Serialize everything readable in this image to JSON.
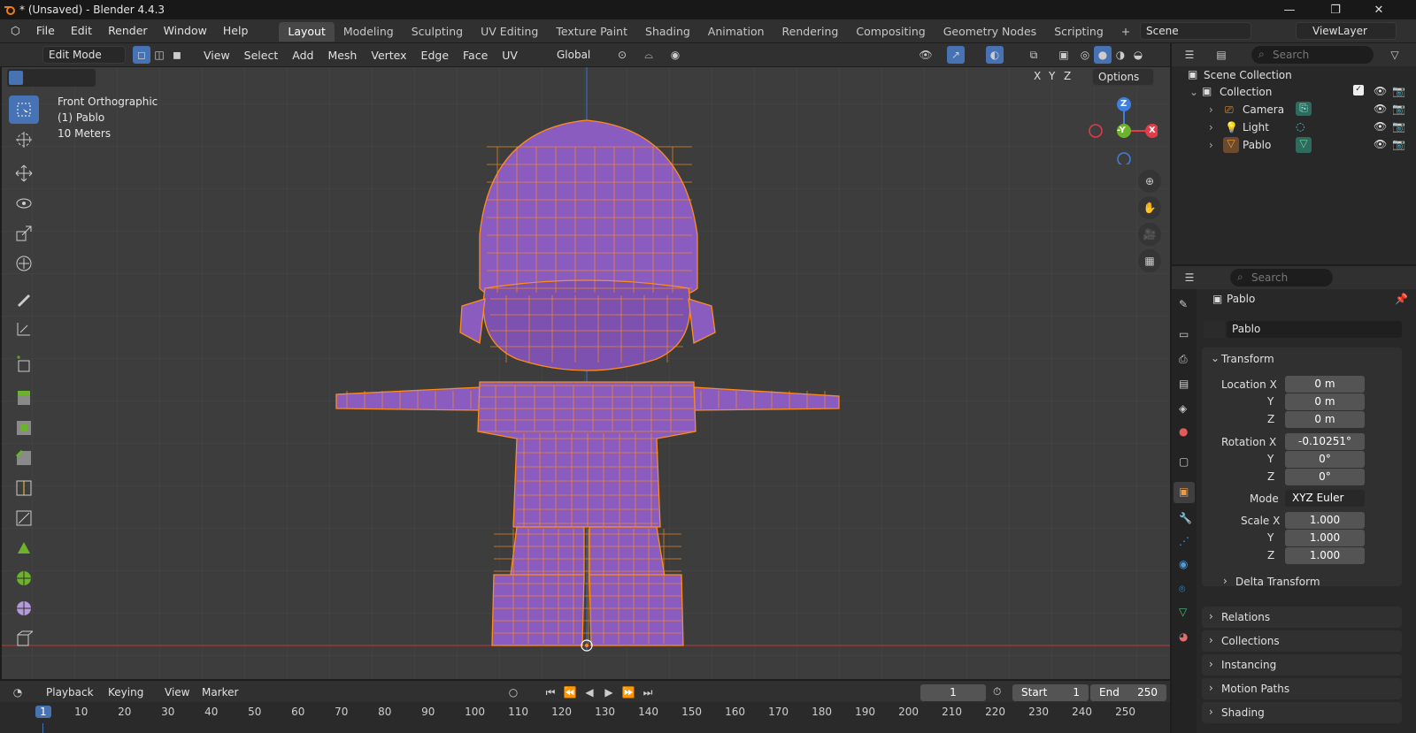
{
  "window": {
    "title": "* (Unsaved) - Blender 4.4.3"
  },
  "menus": [
    "File",
    "Edit",
    "Render",
    "Window",
    "Help"
  ],
  "workspaces": [
    "Layout",
    "Modeling",
    "Sculpting",
    "UV Editing",
    "Texture Paint",
    "Shading",
    "Animation",
    "Rendering",
    "Compositing",
    "Geometry Nodes",
    "Scripting"
  ],
  "scene": {
    "label": "Scene",
    "view_layer": "ViewLayer"
  },
  "viewport_header": {
    "mode": "Edit Mode",
    "menus": [
      "View",
      "Select",
      "Add",
      "Mesh",
      "Vertex",
      "Edge",
      "Face",
      "UV"
    ],
    "transform_orientation": "Global",
    "options": "Options",
    "axes": [
      "X",
      "Y",
      "Z"
    ]
  },
  "overlay_text": {
    "view": "Front Orthographic",
    "object": "(1) Pablo",
    "scale": "10 Meters"
  },
  "gizmo": {
    "z": "Z",
    "y": "-Y",
    "x": "X"
  },
  "outliner": {
    "search_placeholder": "Search",
    "scene_collection": "Scene Collection",
    "collection": "Collection",
    "items": [
      "Camera",
      "Light",
      "Pablo"
    ]
  },
  "properties": {
    "search_placeholder": "Search",
    "object_name": "Pablo",
    "data_name": "Pablo",
    "transform": {
      "title": "Transform",
      "location_label": "Location X",
      "location": [
        "0 m",
        "0 m",
        "0 m"
      ],
      "rotation_label": "Rotation X",
      "rotation": [
        "-0.10251°",
        "0°",
        "0°"
      ],
      "mode_label": "Mode",
      "mode": "XYZ Euler",
      "scale_label": "Scale X",
      "scale": [
        "1.000",
        "1.000",
        "1.000"
      ],
      "y_label": "Y",
      "z_label": "Z",
      "delta": "Delta Transform"
    },
    "panels": [
      "Relations",
      "Collections",
      "Instancing",
      "Motion Paths",
      "Shading"
    ]
  },
  "timeline": {
    "menus": [
      "Playback",
      "Keying",
      "View",
      "Marker"
    ],
    "current_frame": "1",
    "start_label": "Start",
    "start": "1",
    "end_label": "End",
    "end": "250",
    "ticks": [
      "1",
      "10",
      "20",
      "30",
      "40",
      "50",
      "60",
      "70",
      "80",
      "90",
      "100",
      "110",
      "120",
      "130",
      "140",
      "150",
      "160",
      "170",
      "180",
      "190",
      "200",
      "210",
      "220",
      "230",
      "240",
      "250"
    ]
  },
  "colors": {
    "accent": "#4772b3",
    "mesh_face": "#8a5cc0",
    "mesh_edge": "#ff8c1a",
    "x_axis": "#e23c4a",
    "y_axis": "#6cb32c",
    "z_axis": "#3f7fe0"
  }
}
